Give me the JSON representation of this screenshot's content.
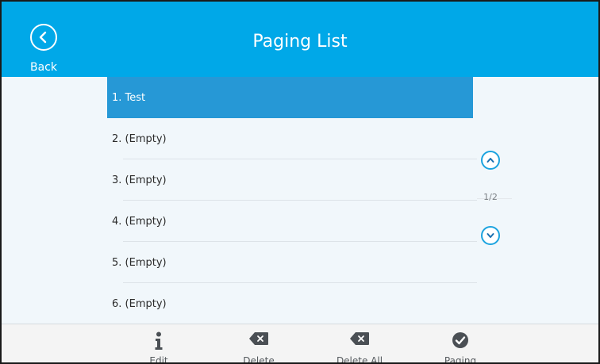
{
  "header": {
    "title": "Paging List",
    "back_label": "Back"
  },
  "list": {
    "items": [
      {
        "label": "1. Test",
        "selected": true
      },
      {
        "label": "2. (Empty)",
        "selected": false
      },
      {
        "label": "3. (Empty)",
        "selected": false
      },
      {
        "label": "4. (Empty)",
        "selected": false
      },
      {
        "label": "5. (Empty)",
        "selected": false
      },
      {
        "label": "6. (Empty)",
        "selected": false
      }
    ]
  },
  "pager": {
    "indicator": "1/2",
    "up_icon": "chevron-up-icon",
    "down_icon": "chevron-down-icon"
  },
  "softkeys": [
    {
      "label": "Edit",
      "icon": "info-icon"
    },
    {
      "label": "Delete",
      "icon": "backspace-icon"
    },
    {
      "label": "Delete All",
      "icon": "backspace-icon"
    },
    {
      "label": "Paging",
      "icon": "check-circle-icon"
    }
  ],
  "colors": {
    "header": "#00a8e8",
    "selected_row": "#2698d6",
    "accent": "#1ba3df",
    "background": "#f1f7fb"
  }
}
